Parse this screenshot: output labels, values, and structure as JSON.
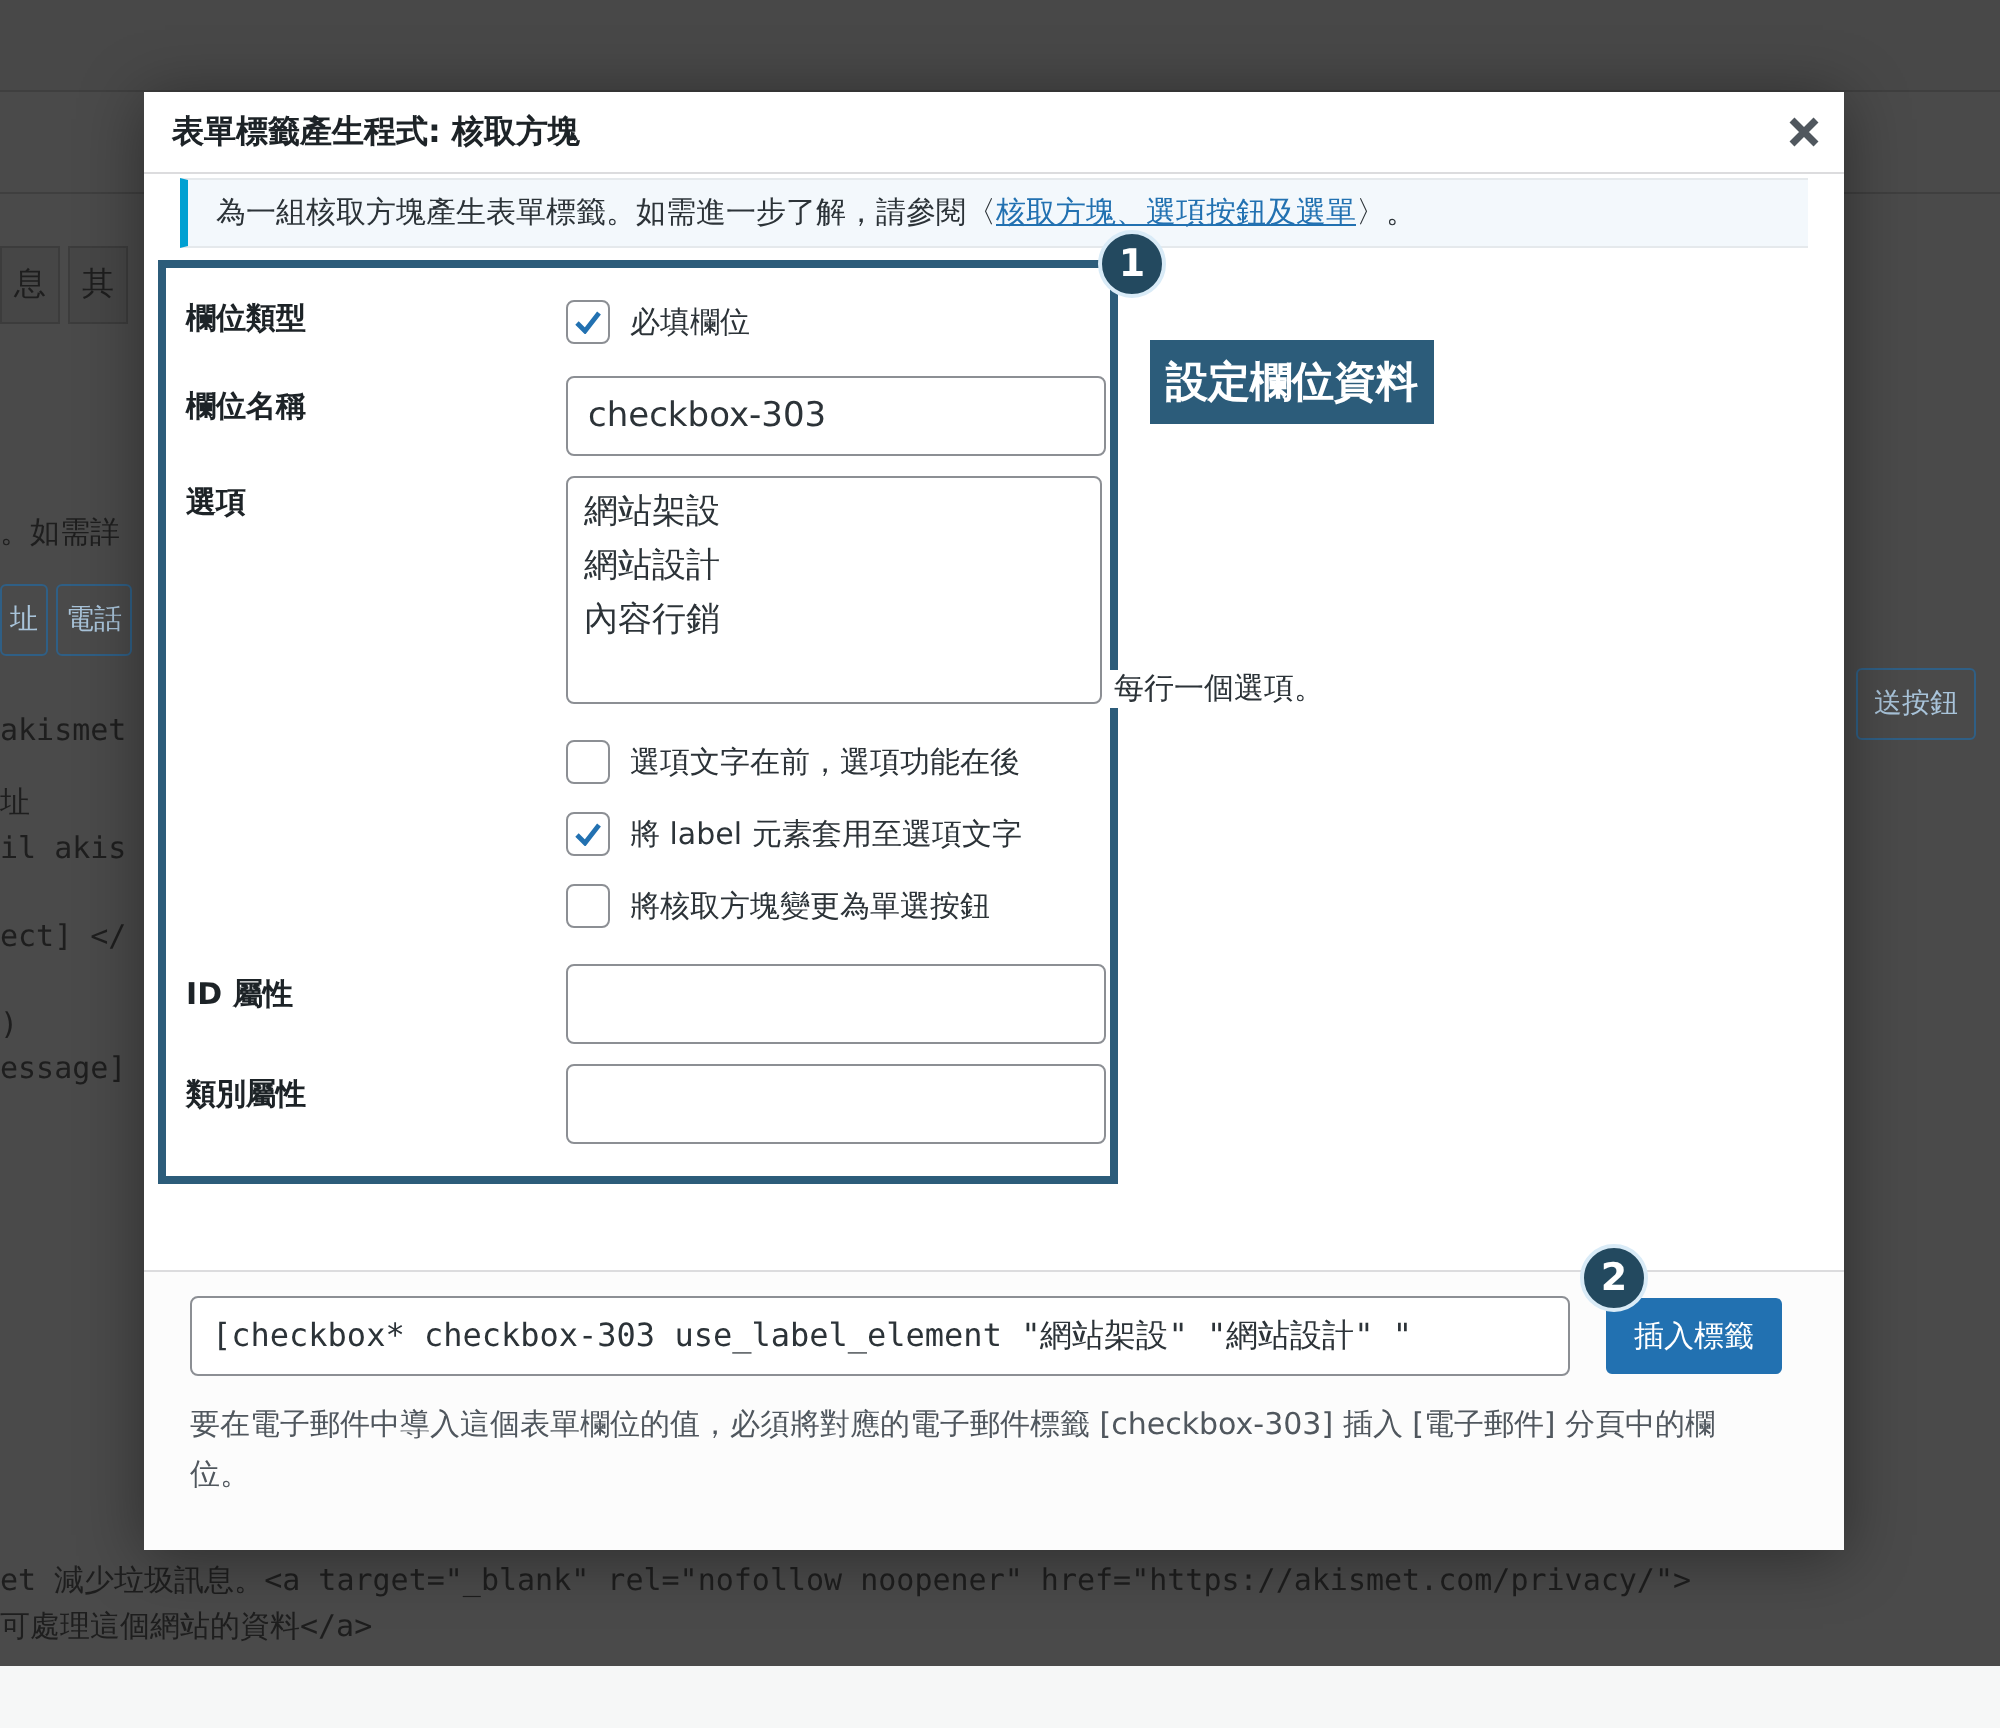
{
  "background": {
    "tabs": [
      "息",
      "其"
    ],
    "note": "。如需詳",
    "left_buttons": [
      "址",
      "電話"
    ],
    "right_button": "送按鈕",
    "code_lines": [
      "akismet",
      "址",
      "il akis",
      "ect] </",
      ")",
      "essage]"
    ],
    "bottom_lines": [
      "et 減少垃圾訊息。<a target=\"_blank\" rel=\"nofollow noopener\" href=\"https://akismet.com/privacy/\">",
      "可處理這個網站的資料</a>"
    ]
  },
  "dialog": {
    "title": "表單標籤產生程式: 核取方塊",
    "notice": {
      "text": "為一組核取方塊產生表單標籤。如需進一步了解，請參閱〈",
      "link": "核取方塊、選項按鈕及選單",
      "after": "〉。"
    },
    "fields": [
      {
        "kind": "checkbox",
        "label": "欄位類型",
        "options": [
          {
            "label": "必填欄位",
            "checked": true
          }
        ]
      },
      {
        "kind": "text",
        "label": "欄位名稱",
        "value": "checkbox-303"
      },
      {
        "kind": "textarea",
        "label": "選項",
        "lines": [
          "網站架設",
          "網站設計",
          "內容行銷"
        ],
        "hint": "每行一個選項。"
      },
      {
        "kind": "checkbox",
        "options": [
          {
            "label": "選項文字在前，選項功能在後",
            "checked": false
          },
          {
            "label": "將 label 元素套用至選項文字",
            "checked": true
          },
          {
            "label": "將核取方塊變更為單選按鈕",
            "checked": false
          }
        ]
      },
      {
        "kind": "text",
        "label": "ID 屬性"
      },
      {
        "kind": "text",
        "label": "類別屬性"
      }
    ],
    "tag": "[checkbox* checkbox-303 use_label_element \"網站架設\" \"網站設計\" \"",
    "insert_button": "插入標籤",
    "description": "要在電子郵件中導入這個表單欄位的值，必須將對應的電子郵件標籤 [checkbox-303] 插入 [電子郵件] 分頁中的欄位。"
  },
  "annotations": {
    "badges": [
      "1",
      "2"
    ],
    "callout": "設定欄位資料"
  }
}
